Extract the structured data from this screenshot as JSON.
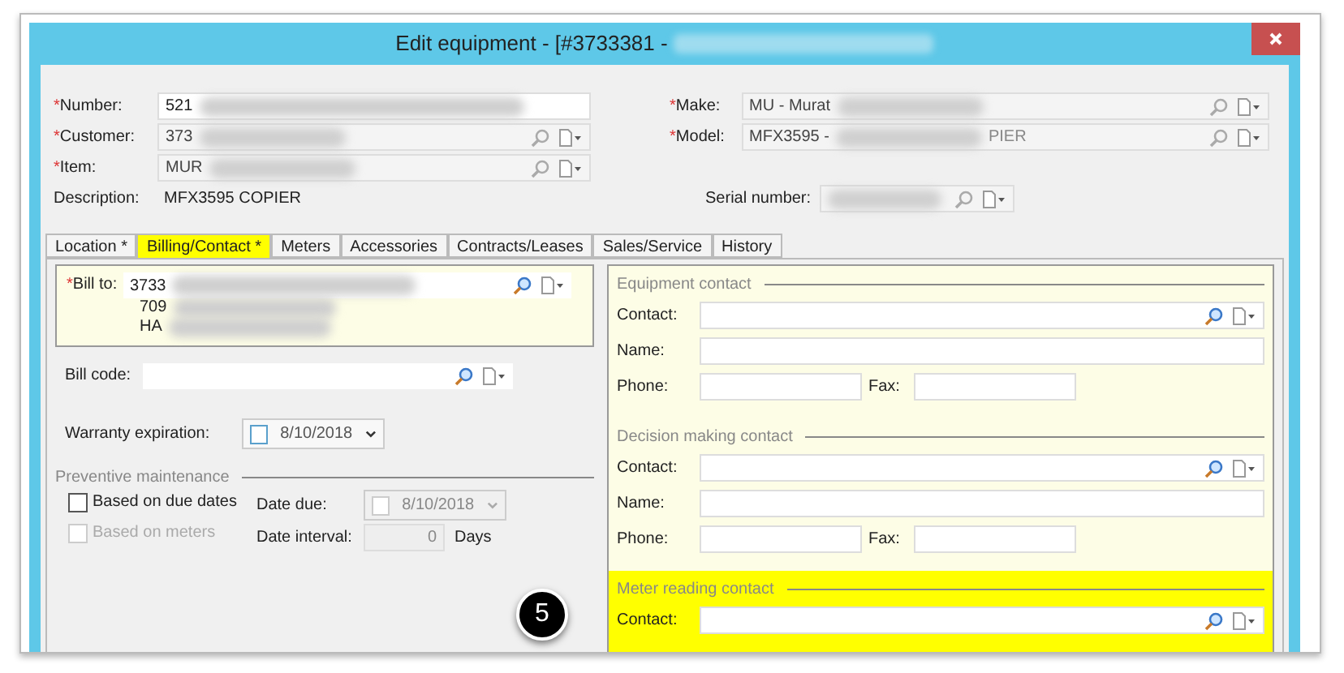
{
  "window": {
    "title": "Edit equipment - [#3733381 -"
  },
  "header_left": [
    {
      "label": "Number:",
      "mark": "*",
      "value": "521",
      "kind": "text"
    },
    {
      "label": "Customer:",
      "mark": "*",
      "value": "373",
      "kind": "lookup"
    },
    {
      "label": "Item:",
      "mark": "*",
      "value": "MUR",
      "kind": "lookup"
    },
    {
      "label": "Description:",
      "value": "MFX3595 COPIER",
      "kind": "plain"
    }
  ],
  "header_right": [
    {
      "label": "Make:",
      "mark": "*",
      "value": "MU - Murat",
      "kind": "lookup"
    },
    {
      "label": "Model:",
      "mark": "*",
      "value": "MFX3595 -",
      "value_end": "PIER",
      "kind": "lookup"
    },
    {
      "label": "Serial number:",
      "kind": "serial"
    }
  ],
  "tabs": [
    {
      "label": "Location *",
      "selected": false,
      "highlighted": false
    },
    {
      "label": "Billing/Contact *",
      "selected": true,
      "highlighted": true
    },
    {
      "label": "Meters",
      "selected": false,
      "highlighted": false
    },
    {
      "label": "Accessories",
      "selected": false,
      "highlighted": false
    },
    {
      "label": "Contracts/Leases",
      "selected": false,
      "highlighted": false
    },
    {
      "label": "Sales/Service",
      "selected": false,
      "highlighted": false
    },
    {
      "label": "History",
      "selected": false,
      "highlighted": false
    }
  ],
  "billing": {
    "bill_to": {
      "label": "Bill to:",
      "mark": "*",
      "lines": [
        "3733",
        "709",
        "HA"
      ]
    },
    "bill_code": {
      "label": "Bill code:"
    },
    "warranty": {
      "label": "Warranty expiration:",
      "checked": false,
      "date": "8/10/2018"
    },
    "preventive": {
      "title": "Preventive maintenance",
      "options": [
        {
          "label": "Based on due dates",
          "checked": false,
          "disabled": false
        },
        {
          "label": "Based on meters",
          "checked": false,
          "disabled": true
        }
      ],
      "date_due": {
        "label": "Date due:",
        "date": "8/10/2018",
        "checked": false,
        "disabled": true
      },
      "date_interval": {
        "label": "Date interval:",
        "value": "0",
        "unit": "Days"
      }
    }
  },
  "contacts": [
    {
      "title": "Equipment contact",
      "highlighted": false,
      "fields": [
        {
          "kind": "lookup",
          "label": "Contact:"
        },
        {
          "kind": "text",
          "label": "Name:"
        },
        {
          "kind": "phone_fax",
          "label": "Phone:",
          "label2": "Fax:"
        }
      ]
    },
    {
      "title": "Decision making contact",
      "highlighted": false,
      "fields": [
        {
          "kind": "lookup",
          "label": "Contact:"
        },
        {
          "kind": "text",
          "label": "Name:"
        },
        {
          "kind": "phone_fax",
          "label": "Phone:",
          "label2": "Fax:"
        }
      ]
    },
    {
      "title": "Meter reading contact",
      "highlighted": true,
      "fields": [
        {
          "kind": "lookup",
          "label": "Contact:"
        }
      ]
    }
  ],
  "annotation": {
    "step": "5"
  }
}
